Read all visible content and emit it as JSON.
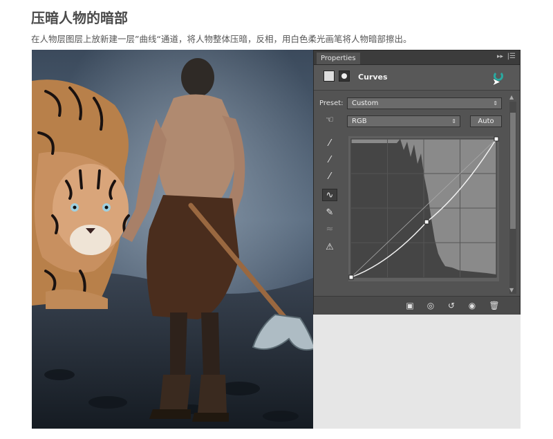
{
  "page": {
    "heading": "压暗人物的暗部",
    "subtitle": "在人物层图层上放新建一层”曲线“通道，将人物整体压暗，反相，用白色柔光画笔将人物暗部擦出。"
  },
  "panel": {
    "tab_label": "Properties",
    "tab_arrows": "▸▸",
    "tab_menu": "|☰",
    "title": "Curves",
    "preset_label": "Preset:",
    "preset_value": "Custom",
    "channel_value": "RGB",
    "auto_label": "Auto",
    "select_arrow": "⇕",
    "icons": {
      "tools": [
        "black-eyedropper-icon",
        "gray-eyedropper-icon",
        "white-eyedropper-icon",
        "curve-edit-icon",
        "pencil-icon",
        "smooth-icon",
        "clipping-warning-icon"
      ],
      "tool_glyphs": [
        "⁄",
        "⁄",
        "⁄",
        "∿",
        "✎",
        "≈",
        "⚠"
      ],
      "bottom": [
        "clip-to-layer-icon",
        "view-previous-icon",
        "reset-icon",
        "visibility-eye-icon",
        "trash-icon"
      ],
      "bottom_glyphs": [
        "▣",
        "◎",
        "↺",
        "◉",
        "🗑"
      ]
    },
    "curve_points": [
      [
        0,
        0
      ],
      [
        0.52,
        0.4
      ],
      [
        1,
        1
      ]
    ],
    "accent_color": "#2aa9a0"
  }
}
